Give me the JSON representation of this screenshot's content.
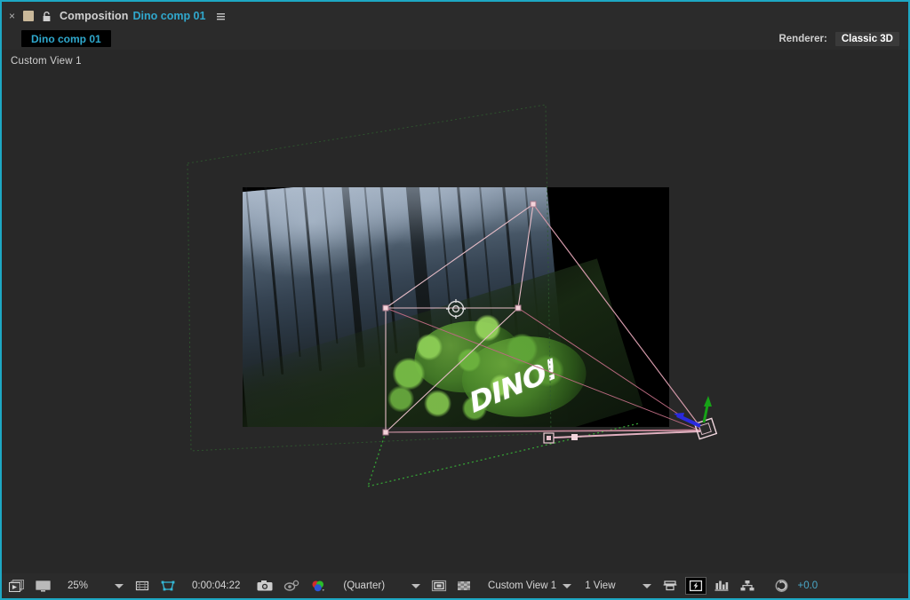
{
  "panel": {
    "close_label": "×",
    "title": "Composition",
    "comp_name": "Dino comp 01",
    "menu_icon": "panel-menu-icon",
    "lock_icon": "lock-icon",
    "color_swatch": "#c9b89a"
  },
  "tabs": [
    {
      "label": "Dino comp 01",
      "active": true
    }
  ],
  "renderer": {
    "label": "Renderer:",
    "value": "Classic 3D"
  },
  "viewport": {
    "view_label": "Custom View 1",
    "background": "#282828",
    "composition": {
      "title_text": "DINO!",
      "layer_outline_color": "#e0b4c0",
      "camera_cone_color": "#cf7f96",
      "motion_path_color": "#3aa83a",
      "guide_color": "#2f5a2f",
      "axis_y_color": "#19b319",
      "axis_z_color": "#2a2aff",
      "axis_x_color": "#c01616"
    }
  },
  "toolbar": {
    "main_viewer_icon": "main-viewer-icon",
    "always_preview_icon": "always-preview-icon",
    "zoom_level": "25%",
    "zoom_caret": "chevron-down-icon",
    "grid_guides_icon": "grid-and-guides-icon",
    "mask_icon": "mask-and-shape-path-icon",
    "timecode": "0:00:04:22",
    "snapshot_icon": "snapshot-camera-icon",
    "show_snapshot_icon": "show-snapshot-icon",
    "channel_icon": "show-channel-rgb-icon",
    "resolution": "(Quarter)",
    "resolution_caret": "chevron-down-icon",
    "region_of_interest_icon": "region-of-interest-icon",
    "transparency_grid_icon": "transparency-grid-icon",
    "view_name": "Custom View 1",
    "view_caret": "chevron-down-icon",
    "view_layout": "1 View",
    "view_layout_caret": "chevron-down-icon",
    "pixel_aspect_icon": "pixel-aspect-correction-icon",
    "fast_previews_icon": "fast-previews-icon",
    "timeline_icon": "timeline-icon",
    "flowchart_icon": "comp-flowchart-icon",
    "exposure_reset_icon": "reset-exposure-icon",
    "exposure_value": "+0.0"
  }
}
